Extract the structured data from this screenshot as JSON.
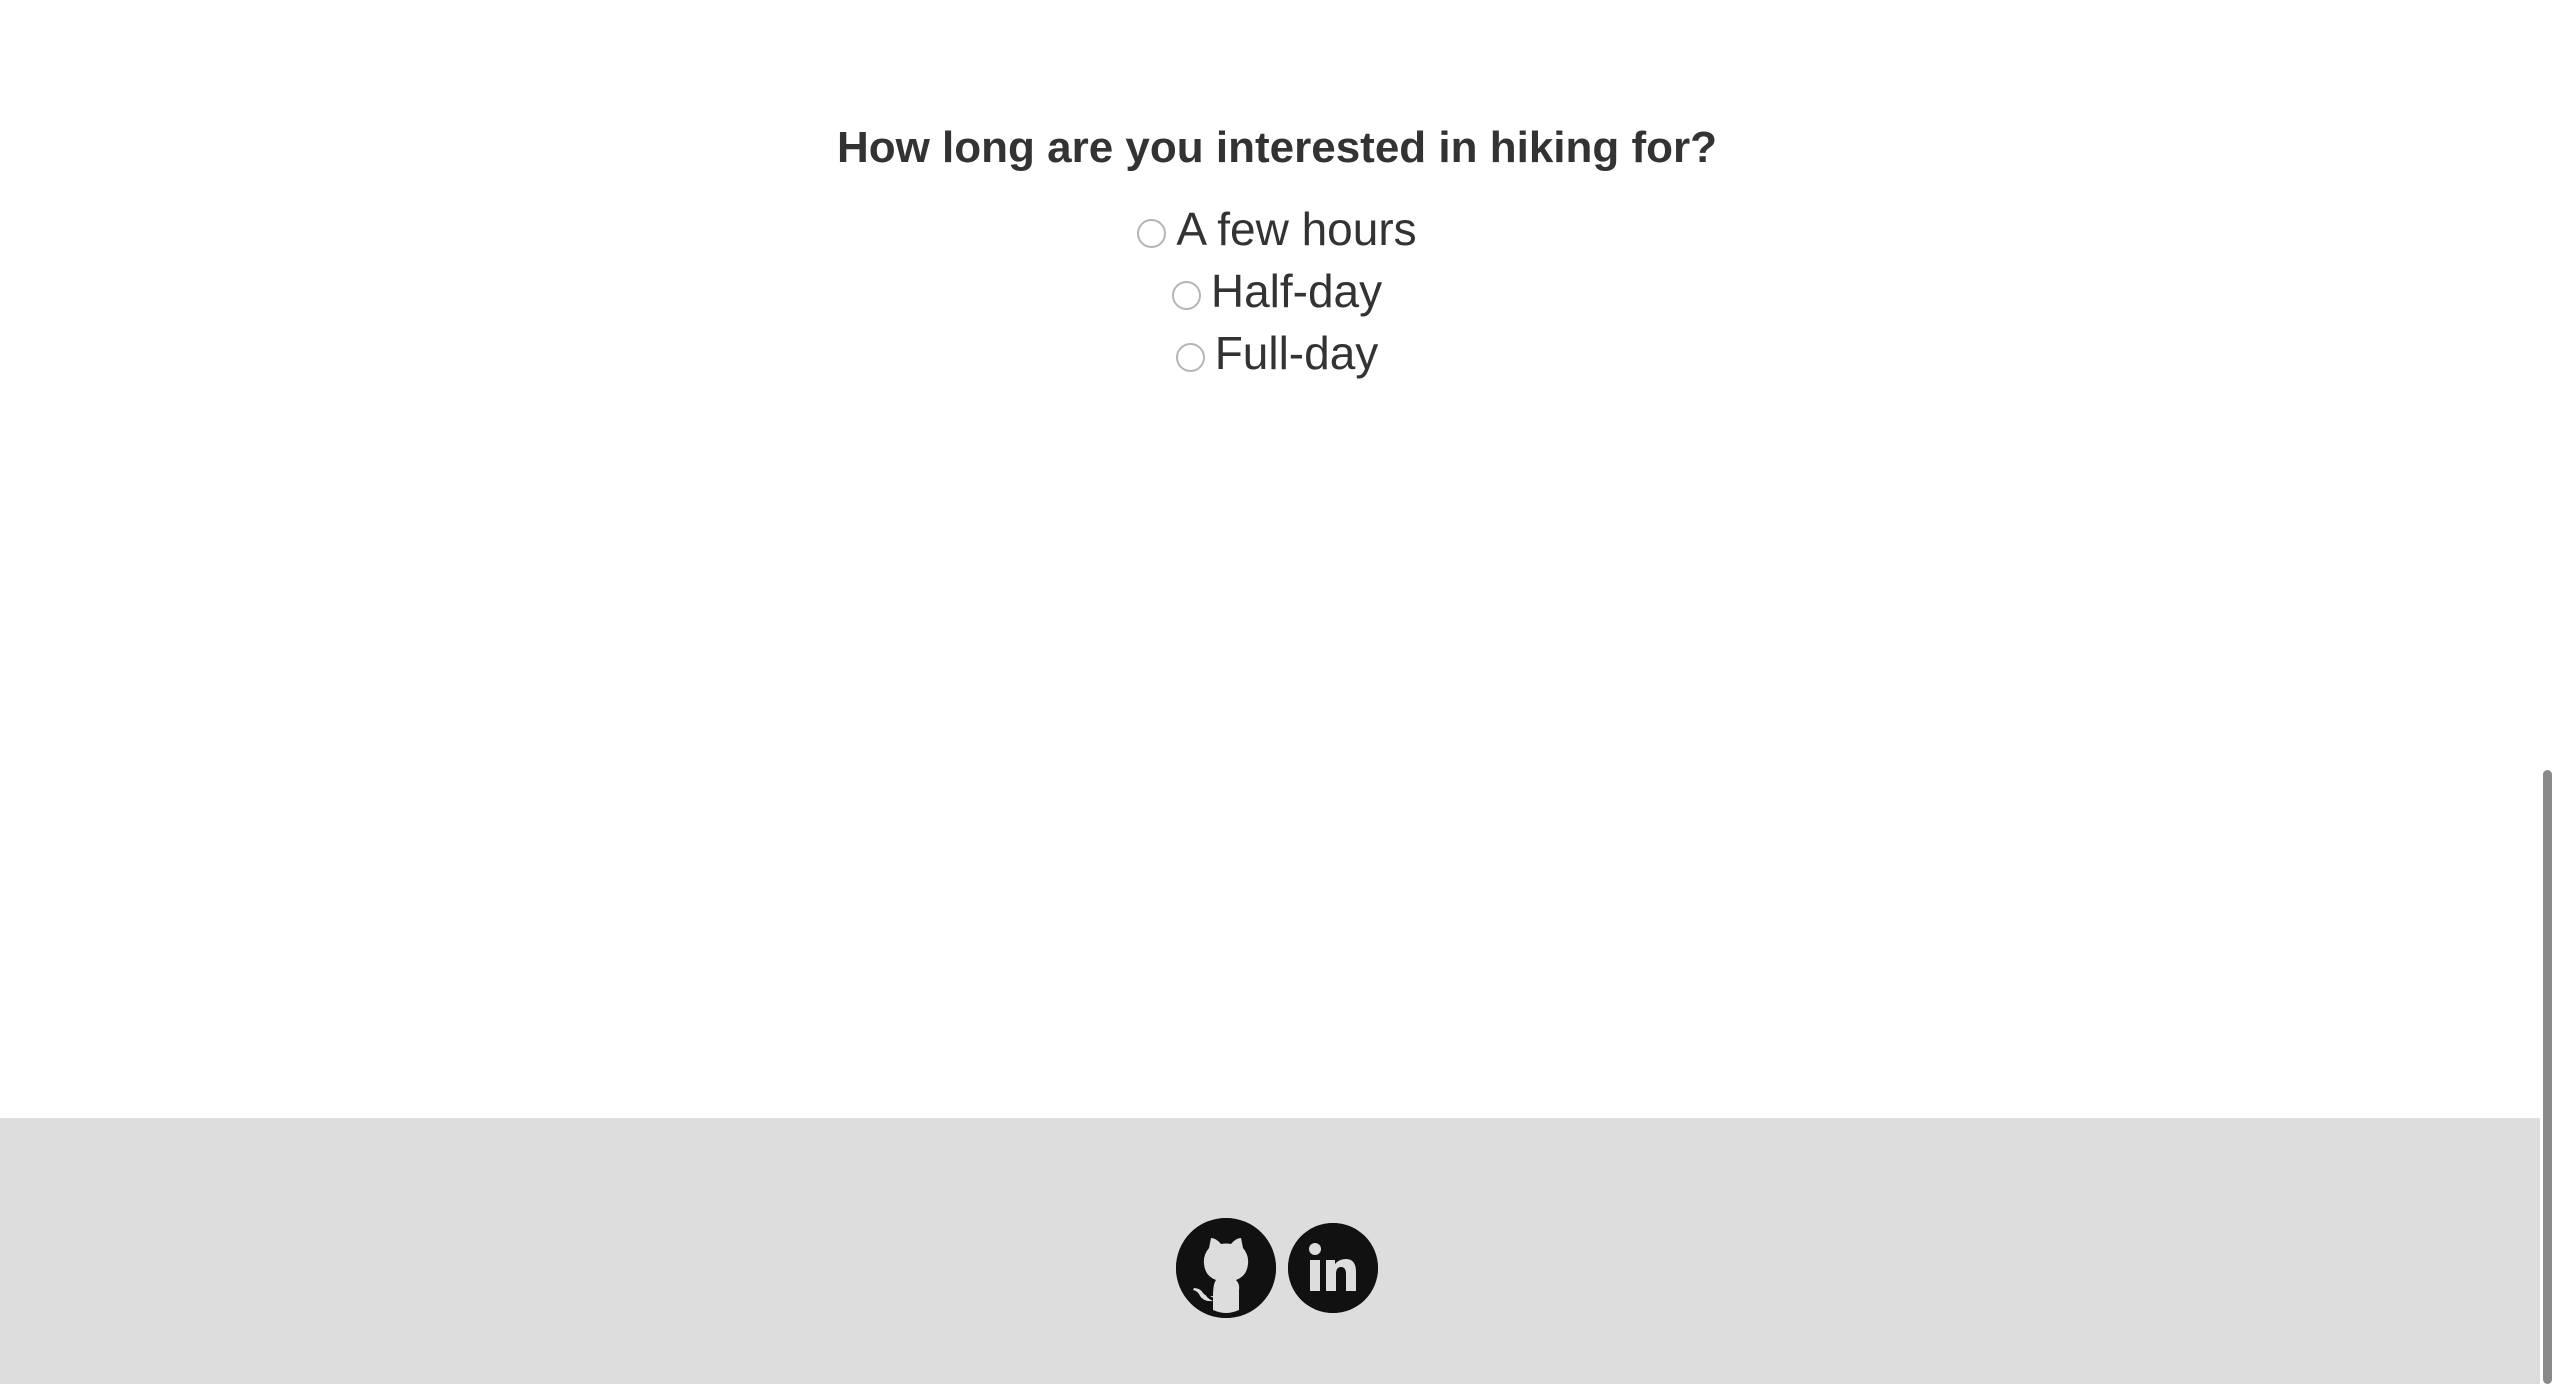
{
  "survey": {
    "question": "How long are you interested in hiking for?",
    "options": [
      {
        "label": "A few hours",
        "selected": false
      },
      {
        "label": "Half-day",
        "selected": false
      },
      {
        "label": "Full-day",
        "selected": false
      }
    ]
  },
  "footer": {
    "links": [
      {
        "icon": "github-icon",
        "label": "GitHub"
      },
      {
        "icon": "linkedin-icon",
        "label": "LinkedIn"
      }
    ]
  },
  "colors": {
    "text": "#333333",
    "footer_bg": "#dddddd",
    "icon_fill": "#111111"
  }
}
